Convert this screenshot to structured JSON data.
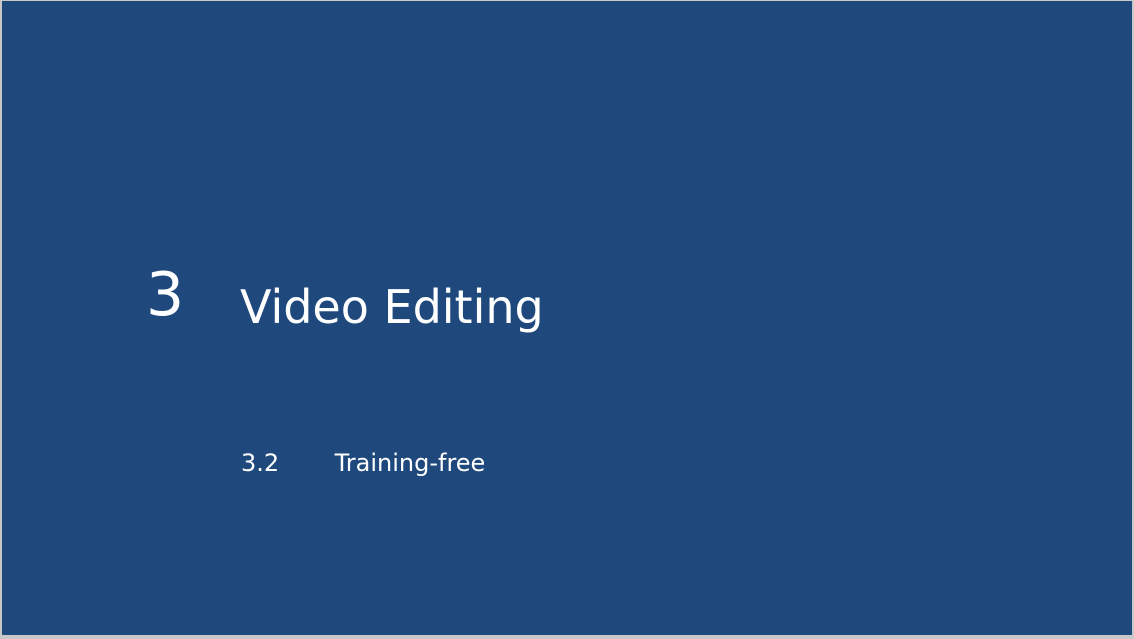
{
  "slide": {
    "background_color": "#1f497d",
    "text_color": "#ffffff",
    "section_number": "3",
    "section_title": "Video Editing",
    "subsection": {
      "number": "3.2",
      "title": "Training-free"
    }
  }
}
